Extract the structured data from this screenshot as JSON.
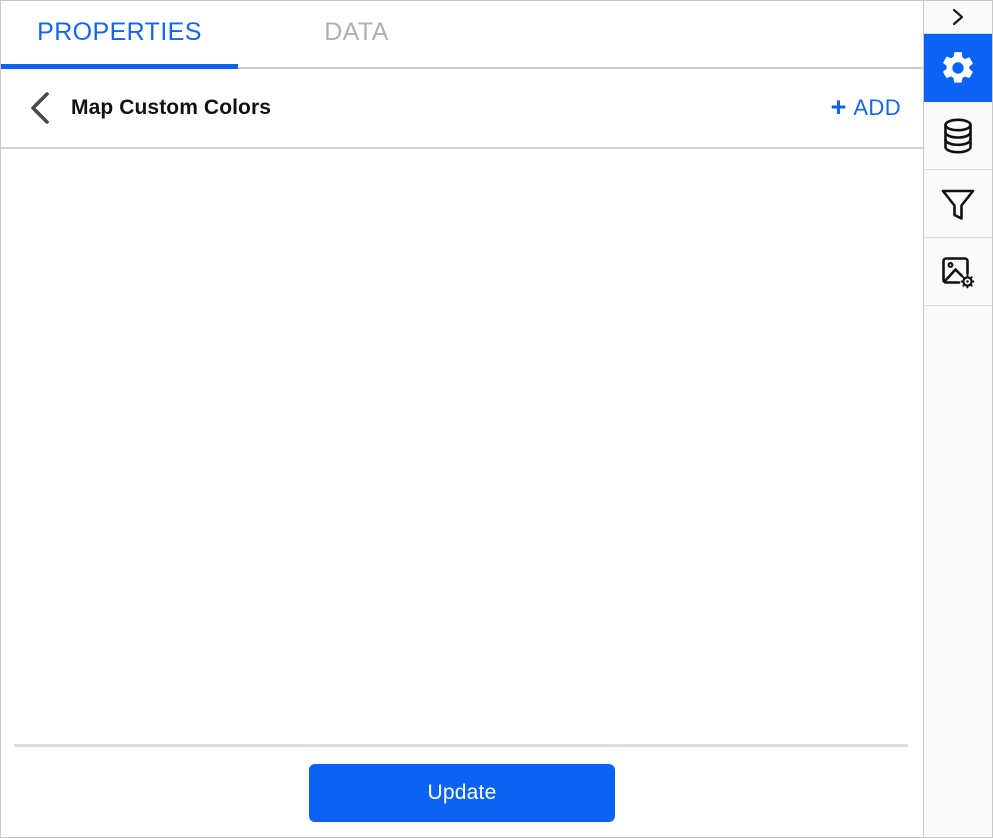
{
  "window": {
    "background": "#ffffff",
    "border_color": "#c8c8c8"
  },
  "tabs": {
    "items": [
      {
        "id": "properties",
        "label": "PROPERTIES",
        "active": true,
        "color": "#1266f1"
      },
      {
        "id": "data",
        "label": "DATA",
        "active": false,
        "color": "#b0b0b0"
      }
    ],
    "active_indicator_color": "#0b63f6"
  },
  "section_header": {
    "back_icon": "chevron-left-icon",
    "title": "Map Custom Colors",
    "add": {
      "plus": "+",
      "label": "ADD",
      "color": "#1266f1"
    }
  },
  "content": {
    "items": [],
    "empty": true
  },
  "footer": {
    "update_label": "Update",
    "update_color": "#0b63f6",
    "divider_color": "#dedede"
  },
  "sidebar": {
    "background": "#fafafa",
    "active_color": "#0b63f6",
    "items": [
      {
        "id": "collapse",
        "icon": "chevron-right-icon",
        "active": false
      },
      {
        "id": "settings",
        "icon": "gear-icon",
        "active": true
      },
      {
        "id": "data-source",
        "icon": "database-icon",
        "active": false
      },
      {
        "id": "filter",
        "icon": "funnel-icon",
        "active": false
      },
      {
        "id": "image-settings",
        "icon": "image-settings-icon",
        "active": false
      }
    ]
  }
}
